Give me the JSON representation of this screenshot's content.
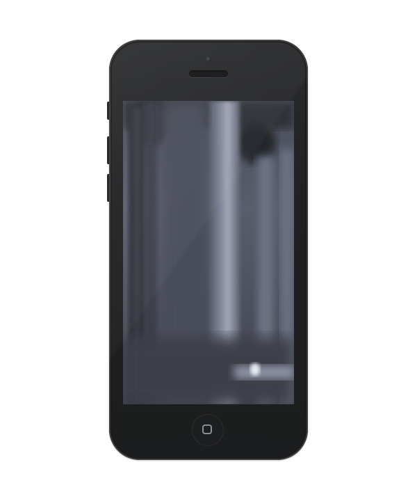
{
  "device": {
    "model": "smartphone",
    "body_color": "#1f2021",
    "screen_content": "blurred-colonnade-video-frame",
    "icons": {
      "camera": "camera-icon",
      "speaker": "earpiece-speaker-icon",
      "home": "home-square-icon"
    }
  },
  "colors": {
    "background": "#ffffff",
    "screen_tint": "#5a6070"
  }
}
